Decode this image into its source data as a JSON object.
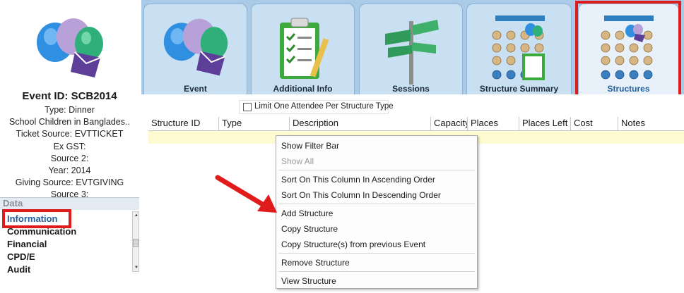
{
  "event": {
    "id_line": "Event ID: SCB2014",
    "type_line": "Type: Dinner",
    "name_line": "School Children in Banglades..",
    "ticket_source_line": "Ticket Source: EVTTICKET",
    "ex_gst_line": "Ex GST:",
    "source2_line": "Source 2:",
    "year_line": "Year: 2014",
    "giving_source_line": "Giving Source: EVTGIVING",
    "source3_line": "Source 3:"
  },
  "data_panel": {
    "header": "Data",
    "items": [
      "Information",
      "Communication",
      "Financial",
      "CPD/E",
      "Audit"
    ]
  },
  "tabs": [
    {
      "label": "Event"
    },
    {
      "label": "Additional Info"
    },
    {
      "label": "Sessions"
    },
    {
      "label": "Structure Summary"
    },
    {
      "label": "Structures"
    }
  ],
  "limit_checkbox": {
    "label": "Limit One Attendee Per Structure Type",
    "checked": false
  },
  "grid": {
    "columns": [
      "Structure ID",
      "Type",
      "Description",
      "Capacity",
      "Places",
      "Places Left",
      "Cost",
      "Notes"
    ]
  },
  "context_menu": {
    "items": [
      {
        "label": "Show Filter Bar",
        "enabled": true
      },
      {
        "label": "Show All",
        "enabled": false
      },
      {
        "label": "Sort On This Column In Ascending Order",
        "enabled": true
      },
      {
        "label": "Sort On This Column In Descending Order",
        "enabled": true
      },
      {
        "label": "Add Structure",
        "enabled": true
      },
      {
        "label": "Copy Structure",
        "enabled": true
      },
      {
        "label": "Copy Structure(s) from previous Event",
        "enabled": true
      },
      {
        "label": "Remove Structure",
        "enabled": true
      },
      {
        "label": "View Structure",
        "enabled": true
      }
    ]
  },
  "colors": {
    "highlight": "#e01b1b",
    "tab_bg": "#a9cbe8",
    "active_tab_label": "#1f5fa0",
    "grid_row": "#fefbd3"
  },
  "icons": [
    "balloons-icon",
    "clipboard-checklist-icon",
    "signpost-icon",
    "seating-plan-icon",
    "seating-layout-icon"
  ]
}
